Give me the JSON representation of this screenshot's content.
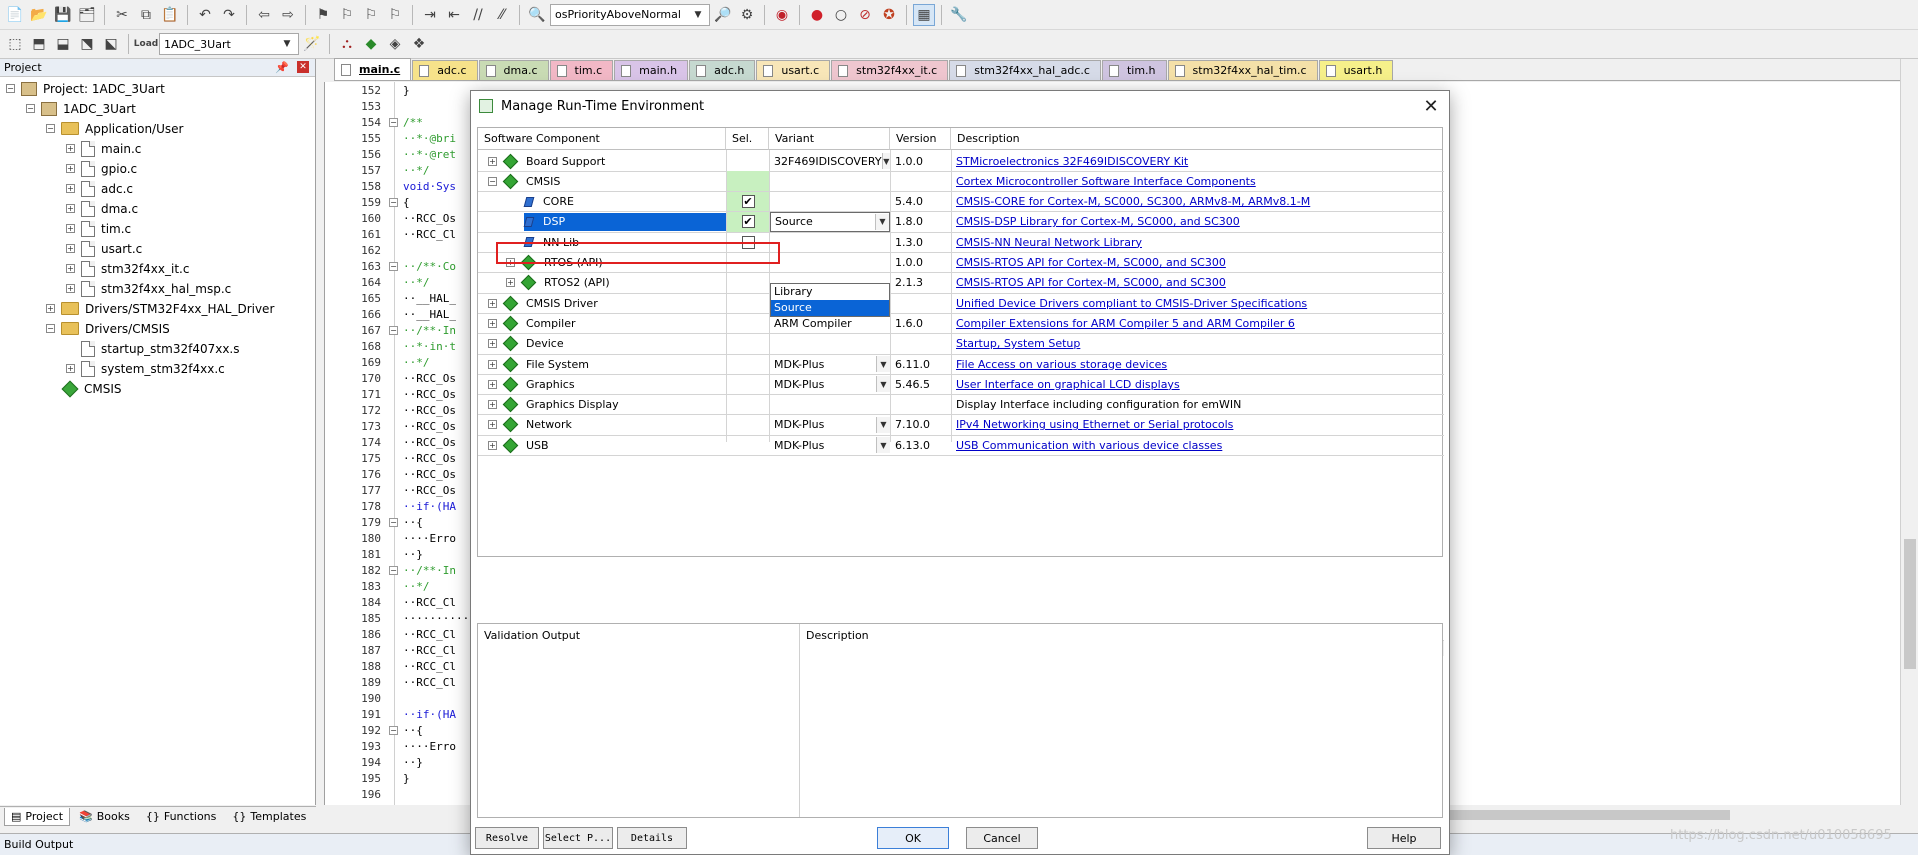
{
  "toolbar1": {
    "priority_combo": "osPriorityAboveNormal"
  },
  "toolbar2": {
    "target_combo": "1ADC_3Uart",
    "load_label": "Load"
  },
  "project_panel": {
    "title": "Project",
    "tree": [
      {
        "label": "Project: 1ADC_3Uart",
        "kind": "root",
        "indent": 0,
        "expander": "−"
      },
      {
        "label": "1ADC_3Uart",
        "kind": "target",
        "indent": 1,
        "expander": "−"
      },
      {
        "label": "Application/User",
        "kind": "folder",
        "indent": 2,
        "expander": "−"
      },
      {
        "label": "main.c",
        "kind": "file",
        "indent": 3,
        "expander": "+"
      },
      {
        "label": "gpio.c",
        "kind": "file",
        "indent": 3,
        "expander": "+"
      },
      {
        "label": "adc.c",
        "kind": "file",
        "indent": 3,
        "expander": "+"
      },
      {
        "label": "dma.c",
        "kind": "file",
        "indent": 3,
        "expander": "+"
      },
      {
        "label": "tim.c",
        "kind": "file",
        "indent": 3,
        "expander": "+"
      },
      {
        "label": "usart.c",
        "kind": "file",
        "indent": 3,
        "expander": "+"
      },
      {
        "label": "stm32f4xx_it.c",
        "kind": "file",
        "indent": 3,
        "expander": "+"
      },
      {
        "label": "stm32f4xx_hal_msp.c",
        "kind": "file",
        "indent": 3,
        "expander": "+"
      },
      {
        "label": "Drivers/STM32F4xx_HAL_Driver",
        "kind": "folder",
        "indent": 2,
        "expander": "+"
      },
      {
        "label": "Drivers/CMSIS",
        "kind": "folder",
        "indent": 2,
        "expander": "−"
      },
      {
        "label": "startup_stm32f407xx.s",
        "kind": "file",
        "indent": 3,
        "expander": ""
      },
      {
        "label": "system_stm32f4xx.c",
        "kind": "file",
        "indent": 3,
        "expander": "+"
      },
      {
        "label": "CMSIS",
        "kind": "component",
        "indent": 2,
        "expander": ""
      }
    ],
    "tabs": [
      "Project",
      "Books",
      "Functions",
      "Templates"
    ]
  },
  "build_output": "Build Output",
  "file_tabs": [
    {
      "label": "main.c",
      "color": "#fff",
      "active": true
    },
    {
      "label": "adc.c",
      "color": "#f6e28a",
      "active": false
    },
    {
      "label": "dma.c",
      "color": "#c9dbb4",
      "active": false
    },
    {
      "label": "tim.c",
      "color": "#f2b8c6",
      "active": false
    },
    {
      "label": "main.h",
      "color": "#d9c4e8",
      "active": false
    },
    {
      "label": "adc.h",
      "color": "#c6d9d0",
      "active": false
    },
    {
      "label": "usart.c",
      "color": "#f8e6b8",
      "active": false
    },
    {
      "label": "stm32f4xx_it.c",
      "color": "#efc6cf",
      "active": false
    },
    {
      "label": "stm32f4xx_hal_adc.c",
      "color": "#d6dbe8",
      "active": false
    },
    {
      "label": "tim.h",
      "color": "#cfc4e0",
      "active": false
    },
    {
      "label": "stm32f4xx_hal_tim.c",
      "color": "#f4e0a8",
      "active": false
    },
    {
      "label": "usart.h",
      "color": "#f6f08a",
      "active": false
    }
  ],
  "editor": {
    "lines": [
      {
        "n": "152",
        "code": "}",
        "fold": ""
      },
      {
        "n": "153",
        "code": "",
        "fold": ""
      },
      {
        "n": "154",
        "code": "/**",
        "cls": "cm",
        "fold": "−"
      },
      {
        "n": "155",
        "code": "··*·@bri",
        "cls": "cm",
        "fold": ""
      },
      {
        "n": "156",
        "code": "··*·@ret",
        "cls": "cm",
        "fold": ""
      },
      {
        "n": "157",
        "code": "··*/",
        "cls": "cm",
        "fold": ""
      },
      {
        "n": "158",
        "code": "void·Sys",
        "cls": "kw",
        "fold": ""
      },
      {
        "n": "159",
        "code": "{",
        "fold": "−"
      },
      {
        "n": "160",
        "code": "··RCC_Os",
        "fold": ""
      },
      {
        "n": "161",
        "code": "··RCC_Cl",
        "fold": ""
      },
      {
        "n": "162",
        "code": "",
        "fold": ""
      },
      {
        "n": "163",
        "code": "··/**·Co",
        "cls": "cm",
        "fold": "−"
      },
      {
        "n": "164",
        "code": "··*/",
        "cls": "cm",
        "fold": ""
      },
      {
        "n": "165",
        "code": "··__HAL_",
        "fold": ""
      },
      {
        "n": "166",
        "code": "··__HAL_",
        "fold": ""
      },
      {
        "n": "167",
        "code": "··/**·In",
        "cls": "cm",
        "fold": "−"
      },
      {
        "n": "168",
        "code": "··*·in·t",
        "cls": "cm",
        "fold": ""
      },
      {
        "n": "169",
        "code": "··*/",
        "cls": "cm",
        "fold": ""
      },
      {
        "n": "170",
        "code": "··RCC_Os",
        "fold": ""
      },
      {
        "n": "171",
        "code": "··RCC_Os",
        "fold": ""
      },
      {
        "n": "172",
        "code": "··RCC_Os",
        "fold": ""
      },
      {
        "n": "173",
        "code": "··RCC_Os",
        "fold": ""
      },
      {
        "n": "174",
        "code": "··RCC_Os",
        "fold": ""
      },
      {
        "n": "175",
        "code": "··RCC_Os",
        "fold": ""
      },
      {
        "n": "176",
        "code": "··RCC_Os",
        "fold": ""
      },
      {
        "n": "177",
        "code": "··RCC_Os",
        "fold": ""
      },
      {
        "n": "178",
        "code": "··if·(HA",
        "cls": "kw",
        "fold": ""
      },
      {
        "n": "179",
        "code": "··{",
        "fold": "−"
      },
      {
        "n": "180",
        "code": "····Erro",
        "fold": ""
      },
      {
        "n": "181",
        "code": "··}",
        "fold": ""
      },
      {
        "n": "182",
        "code": "··/**·In",
        "cls": "cm",
        "fold": "−"
      },
      {
        "n": "183",
        "code": "··*/",
        "cls": "cm",
        "fold": ""
      },
      {
        "n": "184",
        "code": "··RCC_Cl",
        "fold": ""
      },
      {
        "n": "185",
        "code": "··········",
        "fold": ""
      },
      {
        "n": "186",
        "code": "··RCC_Cl",
        "fold": ""
      },
      {
        "n": "187",
        "code": "··RCC_Cl",
        "fold": ""
      },
      {
        "n": "188",
        "code": "··RCC_Cl",
        "fold": ""
      },
      {
        "n": "189",
        "code": "··RCC_Cl",
        "fold": ""
      },
      {
        "n": "190",
        "code": "",
        "fold": ""
      },
      {
        "n": "191",
        "code": "··if·(HA",
        "cls": "kw",
        "fold": ""
      },
      {
        "n": "192",
        "code": "··{",
        "fold": "−"
      },
      {
        "n": "193",
        "code": "····Erro",
        "fold": ""
      },
      {
        "n": "194",
        "code": "··}",
        "fold": ""
      },
      {
        "n": "195",
        "code": "}",
        "fold": ""
      },
      {
        "n": "196",
        "code": "",
        "fold": ""
      }
    ]
  },
  "dialog": {
    "title": "Manage Run-Time Environment",
    "columns": [
      "Software Component",
      "Sel.",
      "Variant",
      "Version",
      "Description"
    ],
    "rows": [
      {
        "name": "Board Support",
        "level": 0,
        "exp": "+",
        "icon": "diamond",
        "sel": "",
        "variant": "32F469IDISCOVERY",
        "variant_dd": true,
        "version": "1.0.0",
        "desc": "STMicroelectronics 32F469IDISCOVERY Kit",
        "link": true
      },
      {
        "name": "CMSIS",
        "level": 0,
        "exp": "−",
        "icon": "diamond",
        "sel": "green",
        "variant": "",
        "variant_dd": false,
        "version": "",
        "desc": "Cortex Microcontroller Software Interface Components",
        "link": true
      },
      {
        "name": "CORE",
        "level": 1,
        "exp": "",
        "icon": "small",
        "sel": "checked",
        "variant": "",
        "variant_dd": false,
        "version": "5.4.0",
        "desc": "CMSIS-CORE for Cortex-M, SC000, SC300, ARMv8-M, ARMv8.1-M",
        "link": true
      },
      {
        "name": "DSP",
        "level": 1,
        "exp": "",
        "icon": "small",
        "sel": "checked",
        "variant": "Source",
        "variant_dd": true,
        "version": "1.8.0",
        "desc": "CMSIS-DSP Library for Cortex-M, SC000, and SC300",
        "link": true,
        "selected": true
      },
      {
        "name": "NN Lib",
        "level": 1,
        "exp": "",
        "icon": "small",
        "sel": "unchecked",
        "variant": "",
        "variant_dd": false,
        "version": "1.3.0",
        "desc": "CMSIS-NN Neural Network Library",
        "link": true
      },
      {
        "name": "RTOS (API)",
        "level": 1,
        "exp": "+",
        "icon": "diamond",
        "sel": "",
        "variant": "",
        "variant_dd": false,
        "version": "1.0.0",
        "desc": "CMSIS-RTOS API for Cortex-M, SC000, and SC300",
        "link": true
      },
      {
        "name": "RTOS2 (API)",
        "level": 1,
        "exp": "+",
        "icon": "diamond",
        "sel": "",
        "variant": "",
        "variant_dd": false,
        "version": "2.1.3",
        "desc": "CMSIS-RTOS API for Cortex-M, SC000, and SC300",
        "link": true
      },
      {
        "name": "CMSIS Driver",
        "level": 0,
        "exp": "+",
        "icon": "diamond",
        "sel": "",
        "variant": "",
        "variant_dd": false,
        "version": "",
        "desc": "Unified Device Drivers compliant to CMSIS-Driver Specifications",
        "link": true
      },
      {
        "name": "Compiler",
        "level": 0,
        "exp": "+",
        "icon": "diamond",
        "sel": "",
        "variant": "ARM Compiler",
        "variant_dd": false,
        "version": "1.6.0",
        "desc": "Compiler Extensions for ARM Compiler 5 and ARM Compiler 6",
        "link": true
      },
      {
        "name": "Device",
        "level": 0,
        "exp": "+",
        "icon": "diamond",
        "sel": "",
        "variant": "",
        "variant_dd": false,
        "version": "",
        "desc": "Startup, System Setup",
        "link": true
      },
      {
        "name": "File System",
        "level": 0,
        "exp": "+",
        "icon": "diamond",
        "sel": "",
        "variant": "MDK-Plus",
        "variant_dd": true,
        "version": "6.11.0",
        "desc": "File Access on various storage devices",
        "link": true
      },
      {
        "name": "Graphics",
        "level": 0,
        "exp": "+",
        "icon": "diamond",
        "sel": "",
        "variant": "MDK-Plus",
        "variant_dd": true,
        "version": "5.46.5",
        "desc": "User Interface on graphical LCD displays",
        "link": true
      },
      {
        "name": "Graphics Display",
        "level": 0,
        "exp": "+",
        "icon": "diamond",
        "sel": "",
        "variant": "",
        "variant_dd": false,
        "version": "",
        "desc": "Display Interface including configuration for emWIN",
        "link": false
      },
      {
        "name": "Network",
        "level": 0,
        "exp": "+",
        "icon": "diamond",
        "sel": "",
        "variant": "MDK-Plus",
        "variant_dd": true,
        "version": "7.10.0",
        "desc": "IPv4 Networking using Ethernet or Serial protocols",
        "link": true
      },
      {
        "name": "USB",
        "level": 0,
        "exp": "+",
        "icon": "diamond",
        "sel": "",
        "variant": "MDK-Plus",
        "variant_dd": true,
        "version": "6.13.0",
        "desc": "USB Communication with various device classes",
        "link": true
      }
    ],
    "dropdown_options": [
      "Library",
      "Source"
    ],
    "dropdown_selected": "Source",
    "validation": {
      "col1": "Validation Output",
      "col2": "Description"
    },
    "buttons": {
      "resolve": "Resolve",
      "select": "Select P...",
      "details": "Details",
      "ok": "OK",
      "cancel": "Cancel",
      "help": "Help"
    }
  },
  "watermark": "https://blog.csdn.net/u010058695"
}
